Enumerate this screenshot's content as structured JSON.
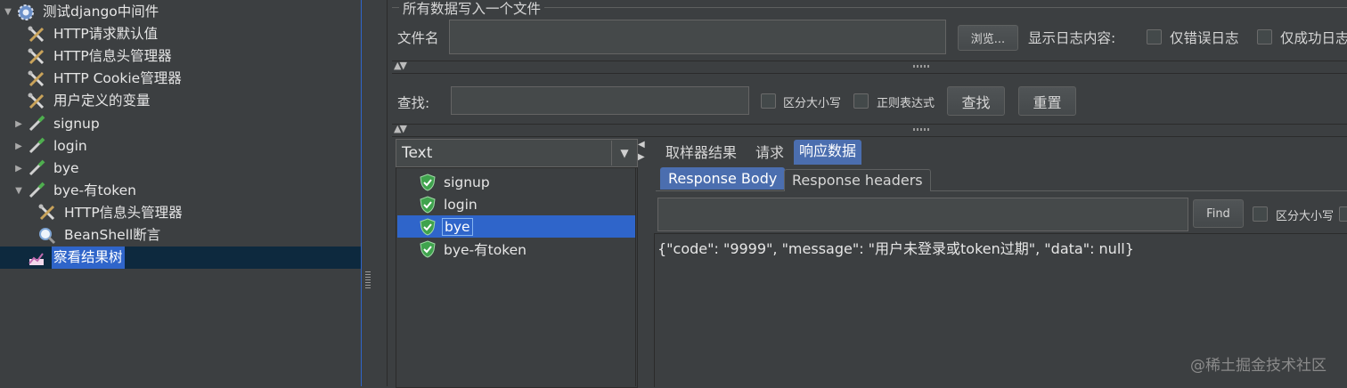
{
  "tree": {
    "items": [
      {
        "label": "测试django中间件",
        "icon": "gear-icon",
        "indent": 0,
        "arrow": "expanded"
      },
      {
        "label": "HTTP请求默认值",
        "icon": "wrench-icon",
        "indent": 1,
        "arrow": "none"
      },
      {
        "label": "HTTP信息头管理器",
        "icon": "wrench-icon",
        "indent": 1,
        "arrow": "none"
      },
      {
        "label": "HTTP Cookie管理器",
        "icon": "wrench-icon",
        "indent": 1,
        "arrow": "none"
      },
      {
        "label": "用户定义的变量",
        "icon": "wrench-icon",
        "indent": 1,
        "arrow": "none"
      },
      {
        "label": "signup",
        "icon": "pipette-icon",
        "indent": 1,
        "arrow": "collapsed"
      },
      {
        "label": "login",
        "icon": "pipette-icon",
        "indent": 1,
        "arrow": "collapsed"
      },
      {
        "label": "bye",
        "icon": "pipette-icon",
        "indent": 1,
        "arrow": "collapsed"
      },
      {
        "label": "bye-有token",
        "icon": "pipette-icon",
        "indent": 1,
        "arrow": "expanded"
      },
      {
        "label": "HTTP信息头管理器",
        "icon": "wrench-icon",
        "indent": 2,
        "arrow": "none"
      },
      {
        "label": "BeanShell断言",
        "icon": "magnifier-icon",
        "indent": 2,
        "arrow": "none"
      },
      {
        "label": "察看结果树",
        "icon": "chart-icon",
        "indent": 1,
        "arrow": "none",
        "selected": true
      }
    ]
  },
  "file_group": {
    "title": "所有数据写入一个文件",
    "filename_label": "文件名",
    "filename_value": "",
    "browse_label": "浏览...",
    "log_label": "显示日志内容:",
    "errors_only_label": "仅错误日志",
    "success_only_label": "仅成功日志"
  },
  "search": {
    "label": "查找:",
    "value": "",
    "case_label": "区分大小写",
    "regex_label": "正则表达式",
    "find_label": "查找",
    "reset_label": "重置"
  },
  "renderer": {
    "selected": "Text"
  },
  "results": [
    {
      "label": "signup",
      "status": "success"
    },
    {
      "label": "login",
      "status": "success"
    },
    {
      "label": "bye",
      "status": "success",
      "selected": true
    },
    {
      "label": "bye-有token",
      "status": "success"
    }
  ],
  "tabs": {
    "sampler": "取样器结果",
    "request": "请求",
    "response": "响应数据"
  },
  "subtabs": {
    "body": "Response Body",
    "headers": "Response headers"
  },
  "response_search": {
    "value": "",
    "find_label": "Find",
    "case_label": "区分大小写"
  },
  "response_body": "{\"code\": \"9999\", \"message\": \"用户未登录或token过期\", \"data\": null}",
  "watermark": "@稀土掘金技术社区",
  "colors": {
    "selection": "#2f65ca",
    "tab_active": "#4b6eaf",
    "success": "#3fa34d"
  }
}
